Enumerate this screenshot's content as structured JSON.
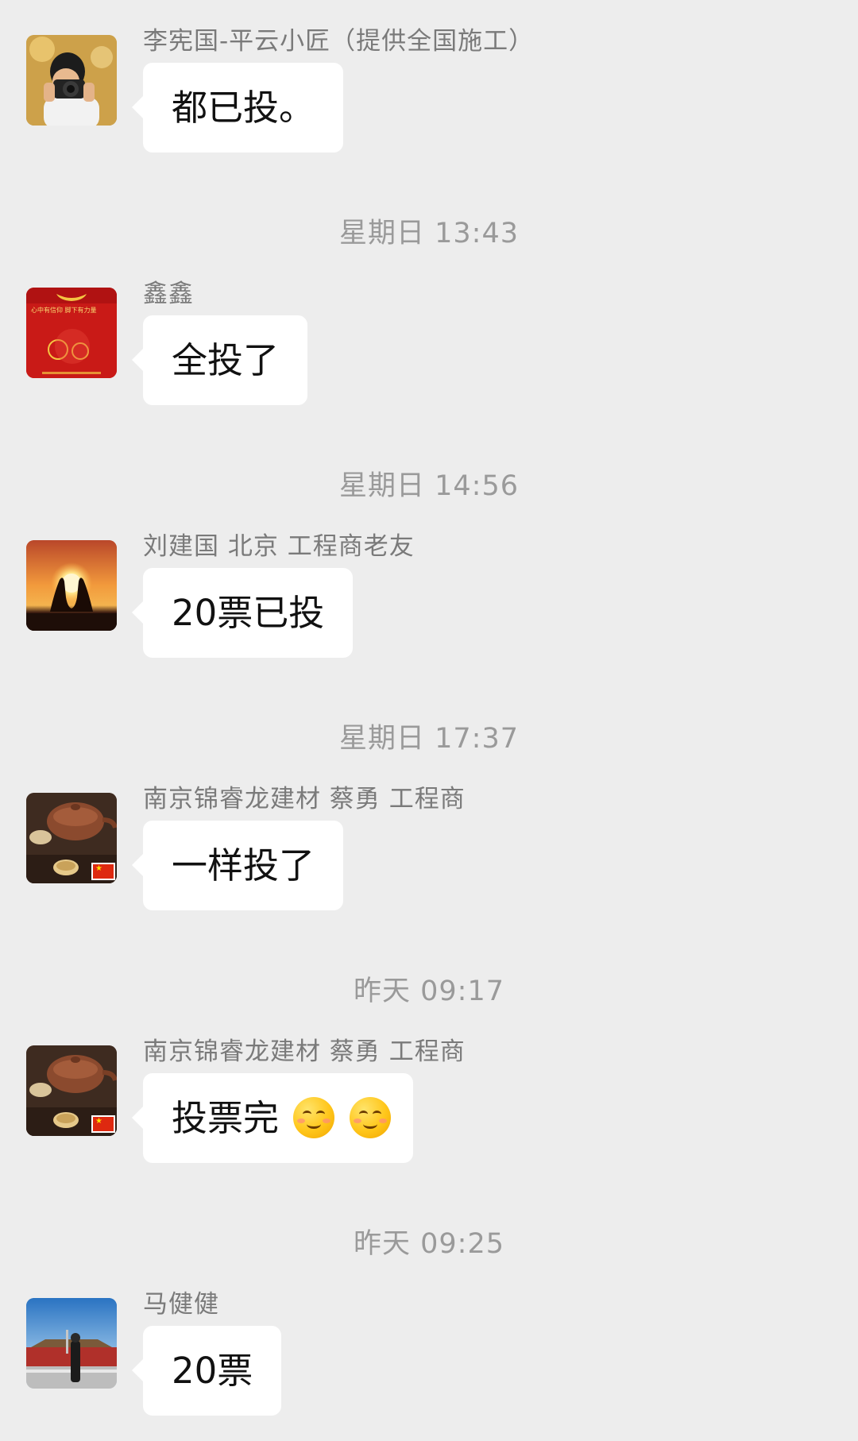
{
  "messages": [
    {
      "sender": "李宪国-平云小匠（提供全国施工）",
      "text": "都已投。",
      "avatar_icon": "photographer-avatar"
    },
    {
      "sender": "鑫鑫",
      "text": "全投了",
      "avatar_icon": "party-emblem-avatar",
      "avatar_caption": "心中有信仰 脚下有力量"
    },
    {
      "sender": "刘建国 北京 工程商老友",
      "text": "20票已投",
      "avatar_icon": "sunset-hands-avatar"
    },
    {
      "sender": "南京锦睿龙建材 蔡勇 工程商",
      "text": "一样投了",
      "avatar_icon": "teapot-avatar"
    },
    {
      "sender": "南京锦睿龙建材 蔡勇 工程商",
      "text": "投票完",
      "emoji": [
        "smiling-face-emoji",
        "smiling-face-emoji"
      ],
      "avatar_icon": "teapot-avatar"
    },
    {
      "sender": "马健健",
      "text": "20票",
      "avatar_icon": "tiananmen-avatar"
    }
  ],
  "timestamps": [
    "星期日 13:43",
    "星期日 14:56",
    "星期日 17:37",
    "昨天 09:17",
    "昨天 09:25"
  ],
  "colors": {
    "background": "#ededed",
    "bubble": "#ffffff",
    "sender": "#7a7a7a",
    "timestamp": "#9a9a9a"
  }
}
